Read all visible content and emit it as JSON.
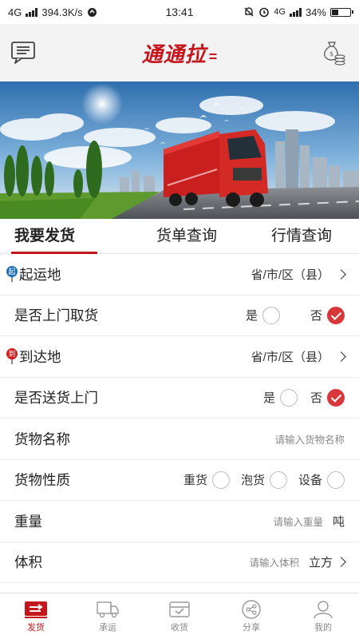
{
  "status_bar": {
    "network": "4G",
    "speed": "394.3K/s",
    "time": "13:41",
    "network_right": "4G",
    "battery": "34%",
    "battery_level": 0.34
  },
  "header": {
    "logo_text": "通通拉",
    "logo_suffix": "=",
    "brand_color": "#c4161c"
  },
  "tabs": [
    {
      "label": "我要发货",
      "active": true
    },
    {
      "label": "货单查询",
      "active": false
    },
    {
      "label": "行情查询",
      "active": false
    }
  ],
  "form": {
    "origin": {
      "badge": "起",
      "label": "起运地",
      "value": "省/市/区（县）"
    },
    "pickup": {
      "label": "是否上门取货",
      "yes": "是",
      "no": "否",
      "selected": "否"
    },
    "destination": {
      "badge": "到",
      "label": "到达地",
      "value": "省/市/区（县）"
    },
    "delivery": {
      "label": "是否送货上门",
      "yes": "是",
      "no": "否",
      "selected": "否"
    },
    "goods_name": {
      "label": "货物名称",
      "placeholder": "请输入货物名称"
    },
    "goods_type": {
      "label": "货物性质",
      "options": [
        "重货",
        "泡货",
        "设备"
      ]
    },
    "weight": {
      "label": "重量",
      "placeholder": "请输入重量",
      "unit": "吨"
    },
    "volume": {
      "label": "体积",
      "placeholder": "请输入体积",
      "unit": "立方"
    }
  },
  "bottom_nav": [
    {
      "label": "发货",
      "icon": "truck-send-icon",
      "active": true
    },
    {
      "label": "承运",
      "icon": "truck-icon",
      "active": false
    },
    {
      "label": "收货",
      "icon": "inbox-check-icon",
      "active": false
    },
    {
      "label": "分享",
      "icon": "share-icon",
      "active": false
    },
    {
      "label": "我的",
      "icon": "user-icon",
      "active": false
    }
  ]
}
